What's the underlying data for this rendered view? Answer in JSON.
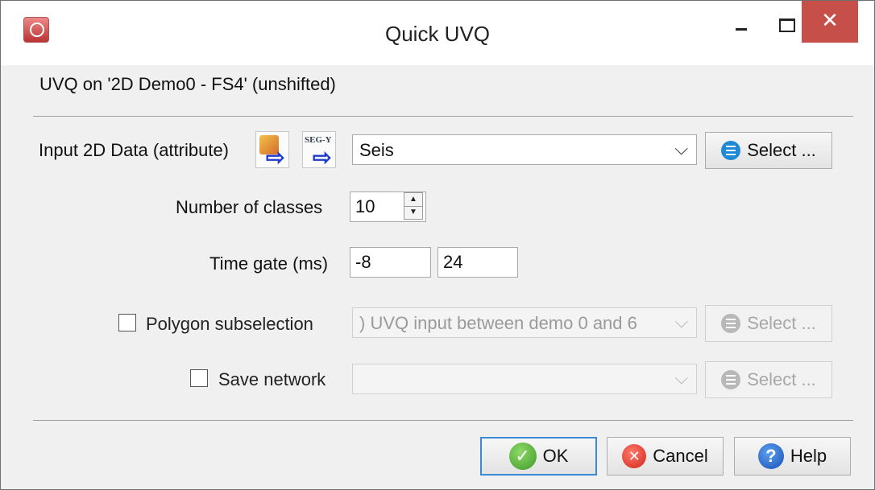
{
  "window": {
    "title": "Quick UVQ"
  },
  "header": "UVQ on '2D Demo0 - FS4' (unshifted)",
  "input": {
    "label": "Input 2D Data (attribute)",
    "value": "Seis",
    "select_label": "Select ..."
  },
  "classes": {
    "label": "Number of classes",
    "value": "10"
  },
  "timegate": {
    "label": "Time gate (ms)",
    "start": "-8",
    "end": "24"
  },
  "polygon": {
    "label": "Polygon subselection",
    "checked": false,
    "value": ") UVQ input between demo 0 and 6",
    "select_label": "Select ..."
  },
  "network": {
    "label": "Save network",
    "checked": false,
    "value": "",
    "select_label": "Select ..."
  },
  "buttons": {
    "ok": "OK",
    "cancel": "Cancel",
    "help": "Help"
  },
  "colors": {
    "close_button": "#c74f4a",
    "default_border": "#3a8ad6",
    "select_icon": "#1e8ad6"
  },
  "icons": {
    "app": "app-icon",
    "input_from_project": "import-attribute-icon",
    "input_from_segy": "segy-import-icon",
    "select": "list-icon",
    "ok": "check-icon",
    "cancel": "x-icon",
    "help": "question-icon"
  }
}
